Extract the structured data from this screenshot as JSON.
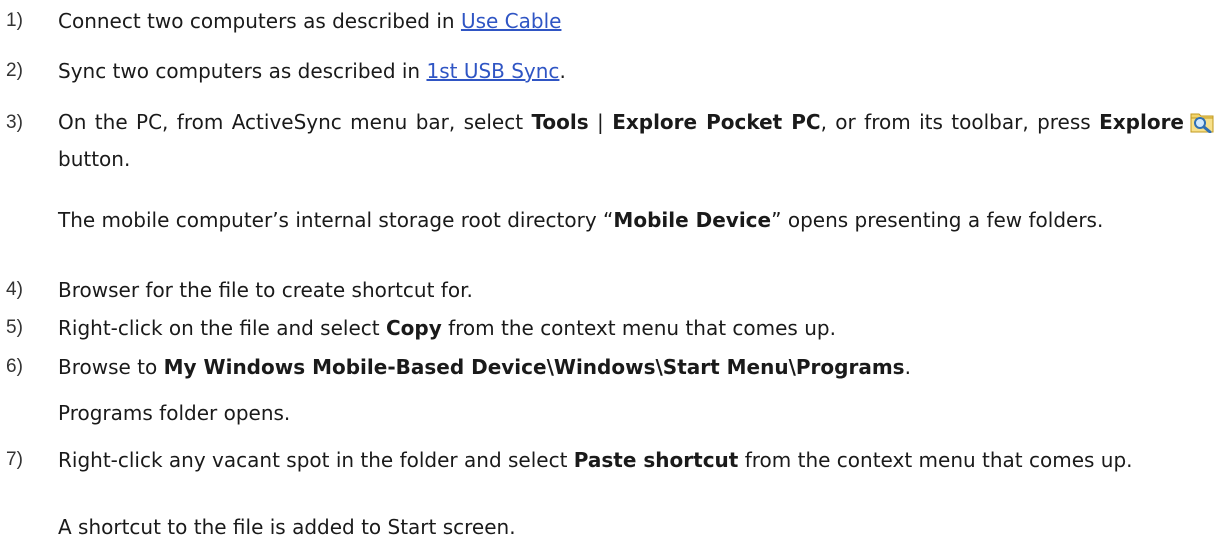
{
  "steps": [
    {
      "num": "1)",
      "pre": "Connect two computers as described in ",
      "link": "Use Cable"
    },
    {
      "num": "2)",
      "pre": "Sync two computers as described in ",
      "link": "1st USB Sync",
      "post": "."
    },
    {
      "num": "3)",
      "pre": "On the PC, from ActiveSync menu bar, select ",
      "b1": "Tools",
      "sep": " | ",
      "b2": "Explore Pocket PC",
      "mid": ", or from its toolbar, press ",
      "b3": "Explore",
      "post": " button."
    },
    {
      "num": "4)",
      "text": "Browser for the file to create shortcut for."
    },
    {
      "num": "5)",
      "pre": "Right-click on the file and select ",
      "b1": "Copy",
      "post": " from the context menu that comes up."
    },
    {
      "num": "6)",
      "pre": "Browse to ",
      "b1": "My Windows Mobile-Based Device\\Windows\\Start Menu\\Programs",
      "post": "."
    },
    {
      "num": "7)",
      "pre": "Right-click any vacant spot in the folder and select ",
      "b1": "Paste shortcut",
      "post": " from the context menu that comes up."
    }
  ],
  "notes": {
    "step3_pre": "The mobile computer’s internal storage root directory “",
    "step3_bold": "Mobile Device",
    "step3_post": "” opens presenting a few folders.",
    "step6": "Programs folder opens.",
    "step7": "A shortcut to the file is added to Start screen."
  },
  "icons": {
    "explore": "explore-magnifier-icon"
  }
}
